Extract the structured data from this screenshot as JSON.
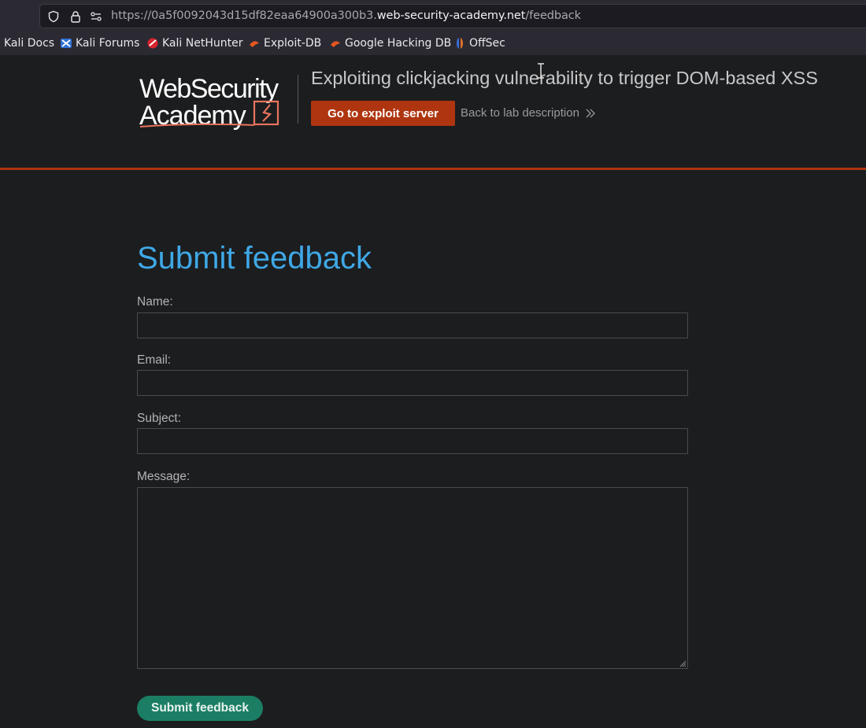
{
  "browser": {
    "url_prefix": "https://0a5f0092043d15df82eaa64900a300b3.",
    "url_domain": "web-security-academy.net",
    "url_path": "/feedback",
    "bookmarks": [
      {
        "label": "Kali Docs",
        "icon": "none"
      },
      {
        "label": "Kali Forums",
        "icon": "kali-forums-icon"
      },
      {
        "label": "Kali NetHunter",
        "icon": "nethunter-icon"
      },
      {
        "label": "Exploit-DB",
        "icon": "exploit-db-icon"
      },
      {
        "label": "Google Hacking DB",
        "icon": "ghdb-icon"
      },
      {
        "label": "OffSec",
        "icon": "offsec-icon"
      }
    ]
  },
  "header": {
    "logo_line1": "WebSecurity",
    "logo_line2": "Academy",
    "lab_title": "Exploiting clickjacking vulnerability to trigger DOM-based XSS",
    "exploit_button": "Go to exploit server",
    "back_link": "Back to lab description",
    "back_icon": "double-chevron-right-icon",
    "accent_color": "#ae3510"
  },
  "form": {
    "title": "Submit feedback",
    "name_label": "Name:",
    "name_value": "",
    "email_label": "Email:",
    "email_value": "",
    "subject_label": "Subject:",
    "subject_value": "",
    "message_label": "Message:",
    "message_value": "",
    "submit_label": "Submit feedback",
    "title_color": "#3fa8e6",
    "button_color": "#1b7e64"
  }
}
